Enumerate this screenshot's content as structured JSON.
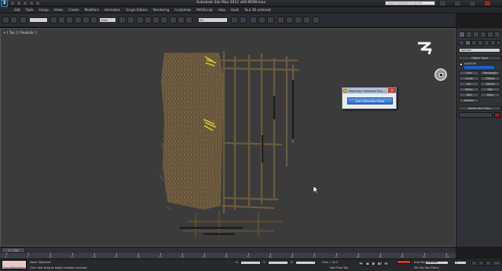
{
  "title_bar": {
    "app_title": "Autodesk 3ds Max  2012 x64      MOW.max",
    "search_placeholder": "Type a keyword or phrase",
    "logo_text": "3"
  },
  "menu": {
    "items": [
      "Edit",
      "Tools",
      "Group",
      "Views",
      "Create",
      "Modifiers",
      "Animation",
      "Graph Editors",
      "Rendering",
      "Customize",
      "MAXScript",
      "Help",
      "Vault",
      "Tout 3D artstreet"
    ]
  },
  "toolbar": {
    "selection_filter": "All",
    "reference_coord": "View",
    "named_selection": ""
  },
  "viewport": {
    "label": "+ [ Top ] [ Realistic ]"
  },
  "dialog": {
    "title": "Warning: Unsaved Sce...",
    "close_glyph": "×",
    "button_label": "Exit Collection Mode"
  },
  "command_panel": {
    "dropdown_value": "Splines",
    "object_type_rollout": "Object Type",
    "autogrid_label": "AutoGrid",
    "buttons": [
      "Line",
      "Rectangle",
      "Circle",
      "Ellipse",
      "Arc",
      "Donut",
      "NGon",
      "Star",
      "Text",
      "Helix",
      "Section",
      ""
    ],
    "name_color_rollout": "Name and Color"
  },
  "time_slider": {
    "label": "0 / 100"
  },
  "trackbar": {
    "ticks": [
      "0",
      "5",
      "10",
      "15",
      "20",
      "25",
      "30",
      "35",
      "40",
      "45",
      "50",
      "55",
      "60",
      "65",
      "70",
      "75",
      "80",
      "85",
      "90",
      "95",
      "100"
    ]
  },
  "status": {
    "script_label": "Parcel&NonaSelect",
    "line1": "None Selected",
    "line2": "Click and drag to begin creation process",
    "x_label": "X:",
    "y_label": "Y:",
    "z_label": "Z:",
    "grid_text": "Grid = 10,0",
    "auto_key": "Auto Key",
    "selected_value": "Selected",
    "set_key": "Set Key",
    "key_filters": "Key Filters...",
    "add_time_tag": "Add Time Tag",
    "playback": [
      "⏮",
      "◀",
      "▶",
      "▶|",
      "⏭"
    ],
    "frame_value": "0"
  },
  "colors": {
    "dialog_button": "#2f6fd0",
    "key_button": "#c93a2a",
    "swatch": "#a01818"
  }
}
